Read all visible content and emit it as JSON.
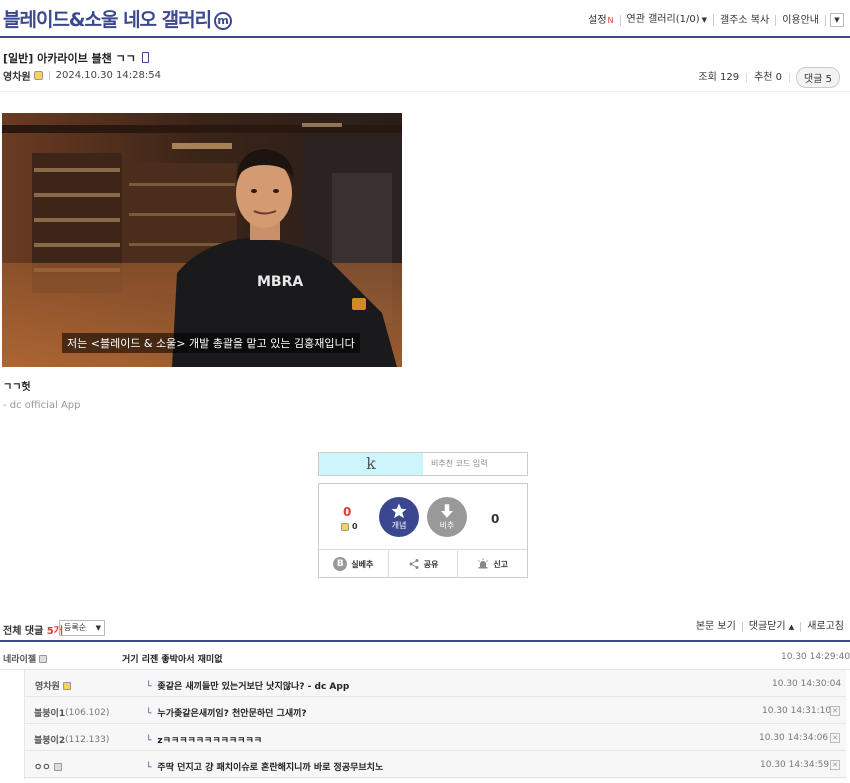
{
  "header": {
    "gallery_title": "블레이드&소울 네오 갤러리",
    "badge": "m",
    "nav": {
      "settings": "설정",
      "settings_new": "N",
      "related": "연관 갤러리(1/0)",
      "copy_url": "갤주소 복사",
      "guide": "이용안내"
    },
    "colors": {
      "brand": "#3b4890",
      "accent_red": "#e53935"
    }
  },
  "post": {
    "title": "[일반] 아카라이브 블챈 ㄱㄱ",
    "author": "영차원",
    "date": "2024.10.30 14:28:54",
    "views": "조회 129",
    "recommends": "추천 0",
    "comments_btn": "댓글 5",
    "video_subtitle": "저는 <블레이드 & 소울> 개발 총괄을 맡고 있는 김홍재입니다",
    "body": "ㄱㄱ헛",
    "app_sign": "- dc official App"
  },
  "recommend_code": {
    "logo": "k",
    "placeholder": "비추천 코드 입력"
  },
  "vote": {
    "up_count": "0",
    "fixnick_up": "0",
    "up_label": "개념",
    "down_label": "비추",
    "down_count": "0",
    "real_best": "실베추",
    "share": "공유",
    "report": "신고"
  },
  "comments_section": {
    "total_prefix": "전체 댓글",
    "total_count": "5개",
    "sort": "등록순",
    "view_post": "본문 보기",
    "close_comments": "댓글닫기",
    "refresh": "새로고침",
    "items": [
      {
        "nick": "네라이젤",
        "ip": "",
        "text": "거기 리젠 좋박아서 재미없",
        "time": "10.30 14:29:40"
      },
      {
        "nick": "영차원",
        "ip": "",
        "text": "좆같은 새끼들만 있는거보단 낫지않나? - dc App",
        "time": "10.30 14:30:04"
      },
      {
        "nick": "블붕이1",
        "ip": "(106.102)",
        "text": "누가좆같은새끼임? 천안문하던 그새끼?",
        "time": "10.30 14:31:10"
      },
      {
        "nick": "블붕이2",
        "ip": "(112.133)",
        "text": "zㅋㅋㅋㅋㅋㅋㅋㅋㅋㅋㅋㅋ",
        "time": "10.30 14:34:06"
      },
      {
        "nick": "ㅇㅇ",
        "ip": "",
        "text": "주딱 던지고 걍 패치이슈로 혼란해지니까 바로 정공무브치노",
        "time": "10.30 14:34:59"
      }
    ]
  }
}
